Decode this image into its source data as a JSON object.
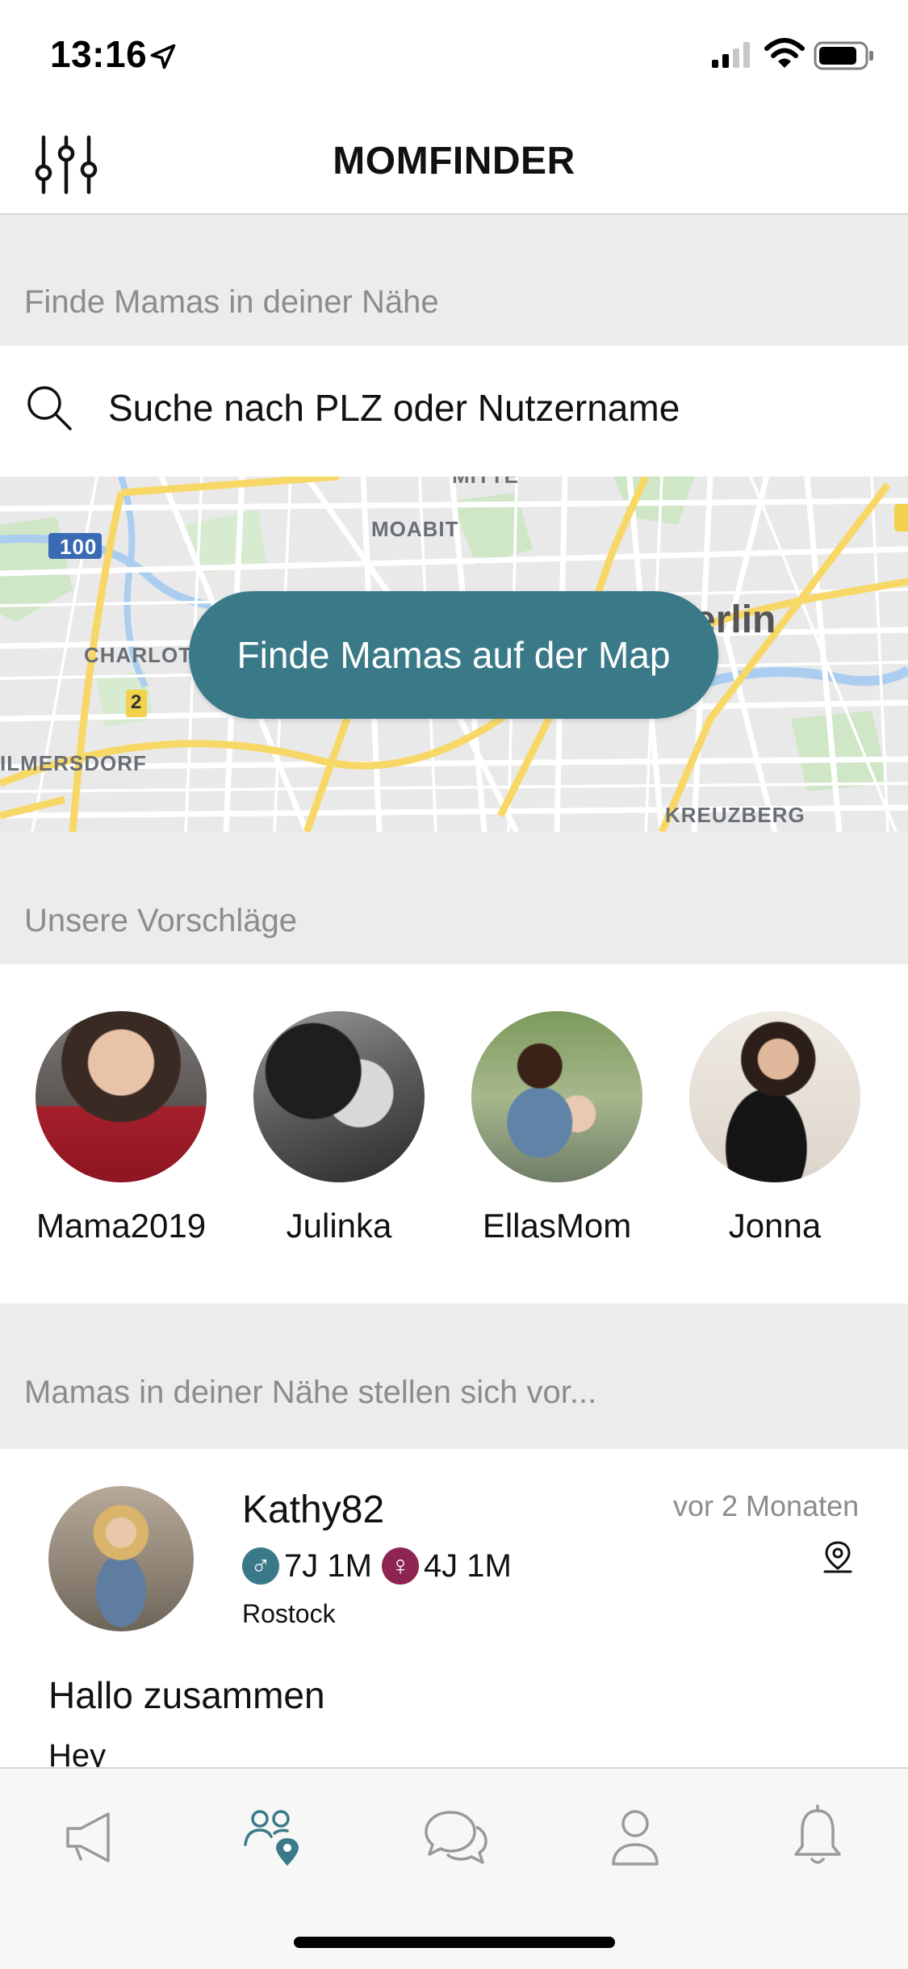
{
  "status_bar": {
    "time": "13:16",
    "icons": [
      "location-arrow-icon",
      "cellular-signal-icon",
      "wifi-icon",
      "battery-icon"
    ]
  },
  "header": {
    "title": "MOMFINDER",
    "filter_icon": "sliders-icon"
  },
  "nearby": {
    "label": "Finde Mamas in deiner Nähe",
    "search": {
      "placeholder": "Suche nach PLZ oder Nutzername",
      "value": ""
    }
  },
  "map": {
    "button_label": "Finde Mamas auf der Map",
    "labels": {
      "moabit": "MOABIT",
      "charlott": "CHARLOTT",
      "ilmersdorf": "ILMERSDORF",
      "kreuzberg": "KREUZBERG",
      "berlin": "erlin",
      "mitte": "MITTE",
      "shield_100": "100",
      "shield_2": "2"
    }
  },
  "suggestions": {
    "label": "Unsere Vorschläge",
    "items": [
      {
        "name": "Mama2019"
      },
      {
        "name": "Julinka"
      },
      {
        "name": "EllasMom"
      },
      {
        "name": "Jonna"
      }
    ]
  },
  "intros": {
    "label": "Mamas in deiner Nähe stellen sich vor...",
    "post": {
      "username": "Kathy82",
      "time": "vor 2 Monaten",
      "kids": [
        {
          "symbol": "♂",
          "age": "7J 1M",
          "color": "#3a7a88"
        },
        {
          "symbol": "♀",
          "age": "4J 1M",
          "color": "#8e2452"
        }
      ],
      "city": "Rostock",
      "title": "Hallo zusammen",
      "body": "Hey"
    }
  },
  "tab_bar": {
    "tabs": [
      "megaphone-icon",
      "people-location-icon",
      "chat-bubbles-icon",
      "profile-icon",
      "bell-icon"
    ],
    "active_index": 1
  },
  "colors": {
    "accent": "#3a7a88",
    "section_bg": "#ececec",
    "muted_text": "#8c8c8c",
    "female_badge": "#8e2452"
  }
}
